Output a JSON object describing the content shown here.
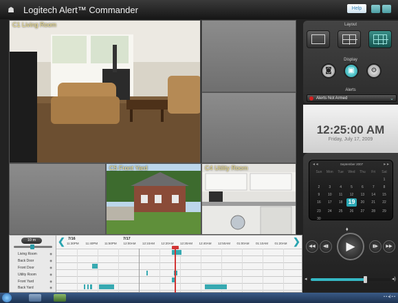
{
  "window": {
    "title": "Logitech Alert™ Commander",
    "help_label": "Help"
  },
  "cameras": {
    "living_room": "C1 Living Room",
    "front_yard": "C5 Front Yard",
    "utility_room": "C4 Utility Room"
  },
  "panel": {
    "layout_caption": "Layout",
    "display_caption": "Display",
    "alerts_caption": "Alerts",
    "alerts_status": "Alerts Not Armed",
    "time": "12:25:00 AM",
    "date": "Friday, July 17, 2009"
  },
  "calendar": {
    "month": "September 2007",
    "weekdays": [
      "Sun",
      "Mon",
      "Tue",
      "Wed",
      "Thu",
      "Fri",
      "Sat"
    ],
    "days": [
      "",
      "",
      "",
      "",
      "",
      "",
      "1",
      "2",
      "3",
      "4",
      "5",
      "6",
      "7",
      "8",
      "9",
      "10",
      "11",
      "12",
      "13",
      "14",
      "15",
      "16",
      "17",
      "18",
      "19",
      "20",
      "21",
      "22",
      "23",
      "24",
      "25",
      "26",
      "27",
      "28",
      "29",
      "30"
    ],
    "selected_day": "19"
  },
  "timeline": {
    "zoom_label": "10 m",
    "rows": [
      "Living Room",
      "Back Door",
      "Front Door",
      "Utility Room",
      "Front Yard",
      "Back Yard"
    ],
    "date_left": "7/16",
    "date_right": "7/17",
    "ticks": [
      "11:30PM",
      "11:40PM",
      "11:50PM",
      "12:00AM",
      "12:10AM",
      "12:20AM",
      "12:30AM",
      "12:40AM",
      "12:50AM",
      "01:00AM",
      "01:10AM",
      "01:20AM"
    ]
  },
  "volume_level": 0.68,
  "colors": {
    "accent": "#2aa7b4",
    "alert_red": "#d32020",
    "cam_label": "#f0e08a"
  },
  "icons": [
    "logitech-logo-icon",
    "camera-icon",
    "monitor-icon",
    "gear-icon",
    "chevron-down-icon",
    "play-icon",
    "skip-back-icon",
    "step-back-icon",
    "step-forward-icon",
    "skip-forward-icon",
    "volume-low-icon",
    "volume-high-icon"
  ]
}
